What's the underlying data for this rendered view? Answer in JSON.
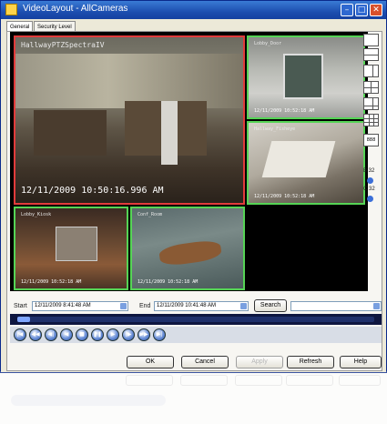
{
  "window": {
    "title": "VideoLayout - AllCameras",
    "min_label": "–",
    "max_label": "□",
    "close_label": "✕"
  },
  "tabs": [
    {
      "label": "General",
      "active": true
    },
    {
      "label": "Security Level",
      "active": false
    }
  ],
  "cameras": [
    {
      "label": "HallwayPTZSpectraIV",
      "timestamp": "12/11/2009  10:50:16.996 AM",
      "border": "#e23b3b"
    },
    {
      "label": "Lobby_Door",
      "timestamp": "12/11/2009 10:52:18 AM",
      "border": "#55d455"
    },
    {
      "label": "Hallway_Fisheye",
      "timestamp": "12/11/2009 10:52:18 AM",
      "border": "#55d455"
    },
    {
      "label": "Lobby_Kiosk",
      "timestamp": "12/11/2009 10:52:18 AM",
      "border": "#55d455"
    },
    {
      "label": "Conf_Room",
      "timestamp": "12/11/2009 10:52:18 AM",
      "border": "#55d455"
    }
  ],
  "side_controls": {
    "b_label": "B 32",
    "c_label": "C 32",
    "grid_label": "888"
  },
  "time_range": {
    "start_label": "Start",
    "start_value": "12/11/2009  8:41:48 AM",
    "end_label": "End",
    "end_value": "12/11/2009 10:41:48 AM",
    "search_label": "Search",
    "preset_value": ""
  },
  "playback": {
    "position_fraction": 0.0
  },
  "buttons": {
    "ok": "OK",
    "cancel": "Cancel",
    "apply": "Apply",
    "refresh": "Refresh",
    "help": "Help"
  },
  "colors": {
    "titlebar": "#1d4fb0",
    "selected_border": "#e23b3b",
    "camera_border": "#55d455",
    "accent": "#3b6fd8"
  }
}
